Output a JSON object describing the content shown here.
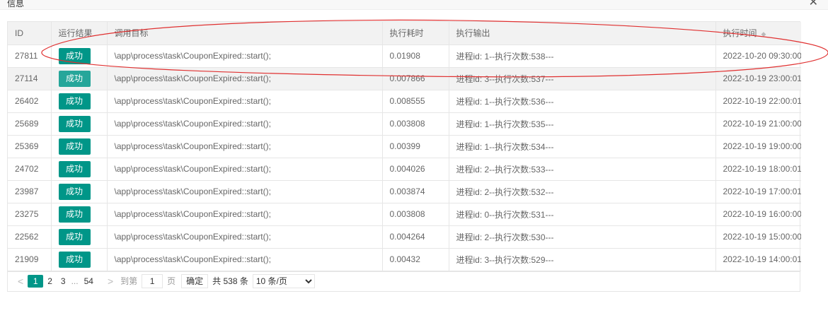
{
  "dialog": {
    "title": "信息",
    "close_icon": "close-icon"
  },
  "table": {
    "columns": [
      "ID",
      "运行结果",
      "调用目标",
      "执行耗时",
      "执行输出",
      "执行时间"
    ],
    "sort_icon": "sort-icon",
    "rows": [
      {
        "id": "27811",
        "status": "成功",
        "target": "\\app\\process\\task\\CouponExpired::start();",
        "duration": "0.01908",
        "output": "进程id: 1--执行次数:538---",
        "time": "2022-10-20 09:30:00"
      },
      {
        "id": "27114",
        "status": "成功",
        "target": "\\app\\process\\task\\CouponExpired::start();",
        "duration": "0.007866",
        "output": "进程id: 3--执行次数:537---",
        "time": "2022-10-19 23:00:01"
      },
      {
        "id": "26402",
        "status": "成功",
        "target": "\\app\\process\\task\\CouponExpired::start();",
        "duration": "0.008555",
        "output": "进程id: 1--执行次数:536---",
        "time": "2022-10-19 22:00:01"
      },
      {
        "id": "25689",
        "status": "成功",
        "target": "\\app\\process\\task\\CouponExpired::start();",
        "duration": "0.003808",
        "output": "进程id: 1--执行次数:535---",
        "time": "2022-10-19 21:00:00"
      },
      {
        "id": "25369",
        "status": "成功",
        "target": "\\app\\process\\task\\CouponExpired::start();",
        "duration": "0.00399",
        "output": "进程id: 1--执行次数:534---",
        "time": "2022-10-19 19:00:00"
      },
      {
        "id": "24702",
        "status": "成功",
        "target": "\\app\\process\\task\\CouponExpired::start();",
        "duration": "0.004026",
        "output": "进程id: 2--执行次数:533---",
        "time": "2022-10-19 18:00:01"
      },
      {
        "id": "23987",
        "status": "成功",
        "target": "\\app\\process\\task\\CouponExpired::start();",
        "duration": "0.003874",
        "output": "进程id: 2--执行次数:532---",
        "time": "2022-10-19 17:00:01"
      },
      {
        "id": "23275",
        "status": "成功",
        "target": "\\app\\process\\task\\CouponExpired::start();",
        "duration": "0.003808",
        "output": "进程id: 0--执行次数:531---",
        "time": "2022-10-19 16:00:00"
      },
      {
        "id": "22562",
        "status": "成功",
        "target": "\\app\\process\\task\\CouponExpired::start();",
        "duration": "0.004264",
        "output": "进程id: 2--执行次数:530---",
        "time": "2022-10-19 15:00:00"
      },
      {
        "id": "21909",
        "status": "成功",
        "target": "\\app\\process\\task\\CouponExpired::start();",
        "duration": "0.00432",
        "output": "进程id: 3--执行次数:529---",
        "time": "2022-10-19 14:00:01"
      }
    ]
  },
  "pagination": {
    "prev": "<",
    "pages": [
      "1",
      "2",
      "3",
      "...",
      "54"
    ],
    "current": "1",
    "next": ">",
    "goto_label": "到第",
    "goto_value": "1",
    "page_unit": "页",
    "confirm": "确定",
    "total": "共 538 条",
    "page_size": "10 条/页"
  },
  "colors": {
    "accent": "#009688",
    "annotation": "#e03030"
  }
}
